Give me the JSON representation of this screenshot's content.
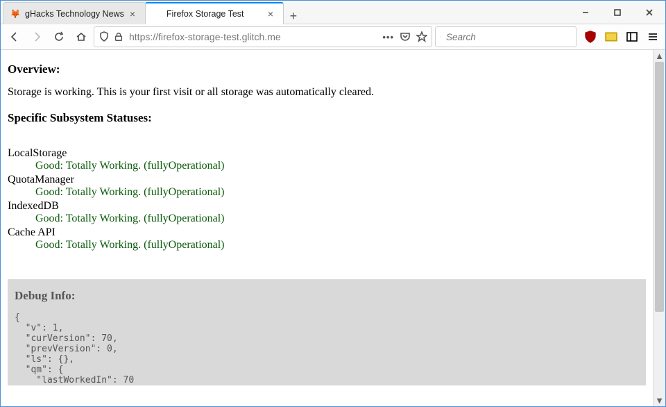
{
  "tabs": [
    {
      "label": "gHacks Technology News",
      "active": false,
      "favicon": "🦊"
    },
    {
      "label": "Firefox Storage Test",
      "active": true,
      "favicon": ""
    }
  ],
  "newtab_tooltip": "New Tab",
  "window_buttons": {
    "min": "Minimize",
    "max": "Maximize",
    "close": "Close"
  },
  "nav": {
    "back": "Back",
    "forward": "Forward",
    "reload": "Reload",
    "home": "Home"
  },
  "urlbar": {
    "url": "https://firefox-storage-test.glitch.me",
    "shield_icon": "tracking-protection-icon",
    "lock_icon": "lock-icon",
    "actions": {
      "more": "•••",
      "pocket": "pocket-icon",
      "star": "star-icon"
    }
  },
  "searchbar": {
    "placeholder": "Search",
    "icon": "search-icon"
  },
  "toolbar_right": {
    "ublock": "uBlock",
    "flag": "flagfox",
    "reader": "reader-view",
    "menu": "menu"
  },
  "page": {
    "overview_heading": "Overview:",
    "overview_text": "Storage is working. This is your first visit or all storage was automatically cleared.",
    "subsystems_heading": "Specific Subsystem Statuses:",
    "subsystems": [
      {
        "name": "LocalStorage",
        "status": "Good: Totally Working. (fullyOperational)"
      },
      {
        "name": "QuotaManager",
        "status": "Good: Totally Working. (fullyOperational)"
      },
      {
        "name": "IndexedDB",
        "status": "Good: Totally Working. (fullyOperational)"
      },
      {
        "name": "Cache API",
        "status": "Good: Totally Working. (fullyOperational)"
      }
    ],
    "debug_heading": "Debug Info:",
    "debug_json": "{\n  \"v\": 1,\n  \"curVersion\": 70,\n  \"prevVersion\": 0,\n  \"ls\": {},\n  \"qm\": {\n    \"lastWorkedIn\": 70"
  }
}
